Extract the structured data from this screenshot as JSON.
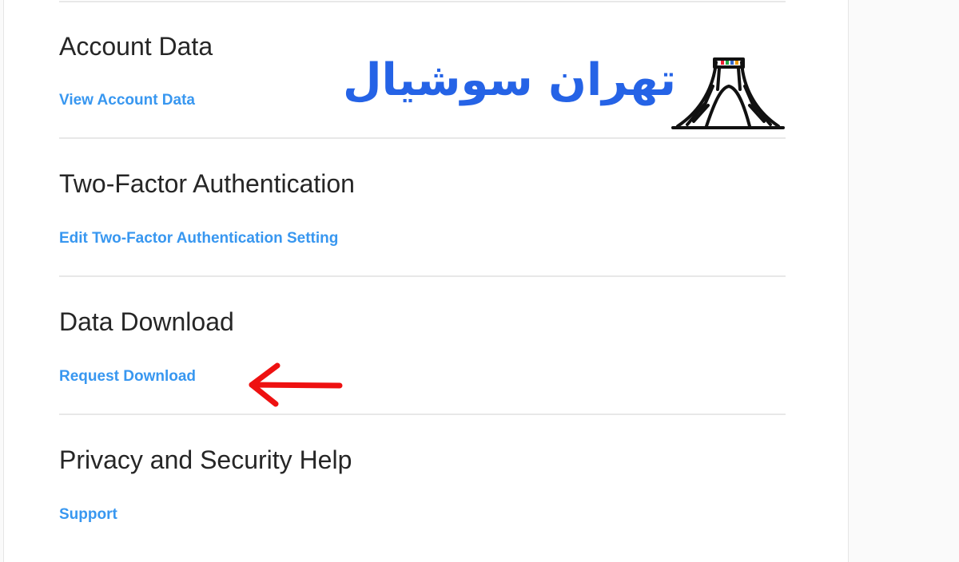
{
  "sections": [
    {
      "title": "Account Data",
      "link": "View Account Data"
    },
    {
      "title": "Two-Factor Authentication",
      "link": "Edit Two-Factor Authentication Setting"
    },
    {
      "title": "Data Download",
      "link": "Request Download"
    },
    {
      "title": "Privacy and Security Help",
      "link": "Support"
    }
  ],
  "watermark": {
    "text": "تهران سوشیال",
    "color": "#2563e6",
    "icon": "azadi-tower-icon"
  },
  "annotation": {
    "icon": "red-arrow-left-icon",
    "color": "#ee1111"
  },
  "colors": {
    "link": "#3897f0",
    "title": "#262626",
    "divider": "#e8e8e8"
  }
}
